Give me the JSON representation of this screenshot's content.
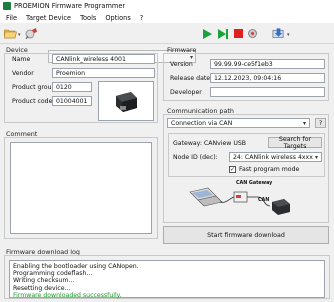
{
  "window": {
    "title": "PROEMION Firmware Programmer"
  },
  "menu": {
    "items": [
      "File",
      "Target Device",
      "Tools",
      "Options",
      "?"
    ]
  },
  "device": {
    "section_title": "Device",
    "name_label": "Name",
    "name_value": "CANlink_wireless 4001",
    "vendor_label": "Vendor",
    "vendor_value": "Proemion",
    "group_label": "Product group",
    "group_value": "0120",
    "code_label": "Product code",
    "code_value": "01004001"
  },
  "comment": {
    "section_title": "Comment",
    "text": ""
  },
  "firmware": {
    "section_title": "Firmware",
    "version_label": "Version",
    "version_value": "99.99.99-ce5f1eb3",
    "date_label": "Release date",
    "date_value": "12.12.2023, 09:04:16",
    "developer_label": "Developer",
    "developer_value": ""
  },
  "comm": {
    "section_title": "Communication path",
    "path_value": "Connection via CAN",
    "help_label": "?",
    "gateway_text": "Gateway: CANview USB",
    "search_label": "Search for Targets",
    "node_label": "Node ID (dec):",
    "node_value": "24: CANlink wireless 4xxx",
    "fast_mode_label": "Fast program mode",
    "fast_mode_checked": true,
    "diagram_gateway_label": "CAN Gateway",
    "diagram_can_label": "CAN"
  },
  "start_button": {
    "label": "Start firmware download"
  },
  "log": {
    "section_title": "Firmware download log",
    "lines": [
      "Enabling the bootloader using CANopen.",
      "Programming codeflash...",
      "Writing checksum...",
      "Resetting device...",
      "Firmware downloaded successfully."
    ]
  },
  "colors": {
    "success_text": "#1b9a2c",
    "toolbar_run": "#1aa33a",
    "toolbar_stop": "#e02020",
    "app_icon": "#1c7d3e"
  },
  "toolbar": {
    "icons": [
      "open-folder-icon",
      "connect-icon",
      "target-combo",
      "play-icon",
      "play-step-icon",
      "stop-icon",
      "settings-icon",
      "download-icon"
    ]
  }
}
